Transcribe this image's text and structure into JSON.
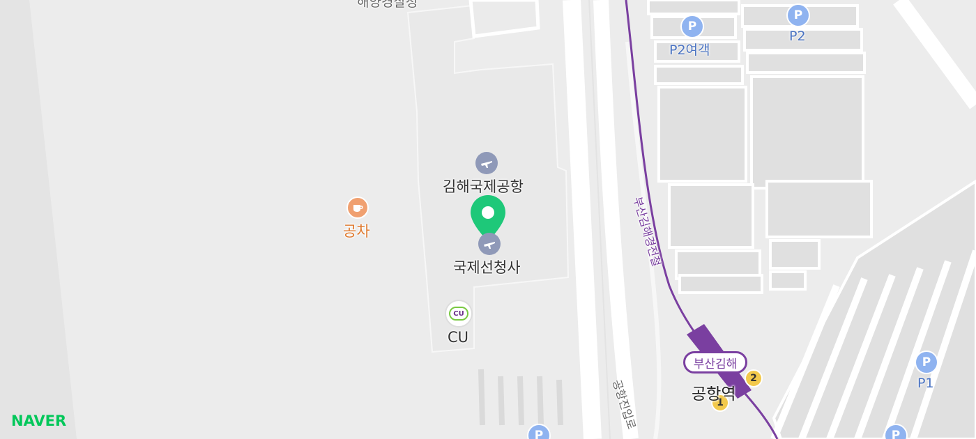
{
  "branding": {
    "logo_text": "NAVER",
    "logo_color": "#03c75a"
  },
  "colors": {
    "background": "#ececec",
    "road": "#ffffff",
    "parking_lot": "#e2e2e2",
    "terminal_building": "#e8e8e8",
    "railway": "#7a3fa0",
    "parking_icon": "#8fb3f0",
    "marker": "#1ec879",
    "cafe_icon": "#f0a070",
    "exit_badge": "#f2c94c"
  },
  "labels": {
    "top_cutoff": "해양경찰청",
    "airport": "김해국제공항",
    "terminal": "국제선청사",
    "cafe": "공차",
    "convenience_store_logo": "CU",
    "convenience_store": "CU",
    "railway_line": "부산김해경전철",
    "station_badge": "부산김해",
    "station_name": "공항역",
    "road_name": "공항진입로"
  },
  "parking": [
    {
      "icon": "P",
      "label": "P2여객"
    },
    {
      "icon": "P",
      "label": "P2"
    },
    {
      "icon": "P",
      "label": "P1"
    },
    {
      "icon": "P",
      "label": ""
    },
    {
      "icon": "P",
      "label": ""
    }
  ],
  "station_exits": [
    "2",
    "1"
  ],
  "icons": {
    "marker": "location-pin-icon",
    "airport": "airplane-icon",
    "cafe": "coffee-cup-icon",
    "parking": "parking-icon"
  }
}
